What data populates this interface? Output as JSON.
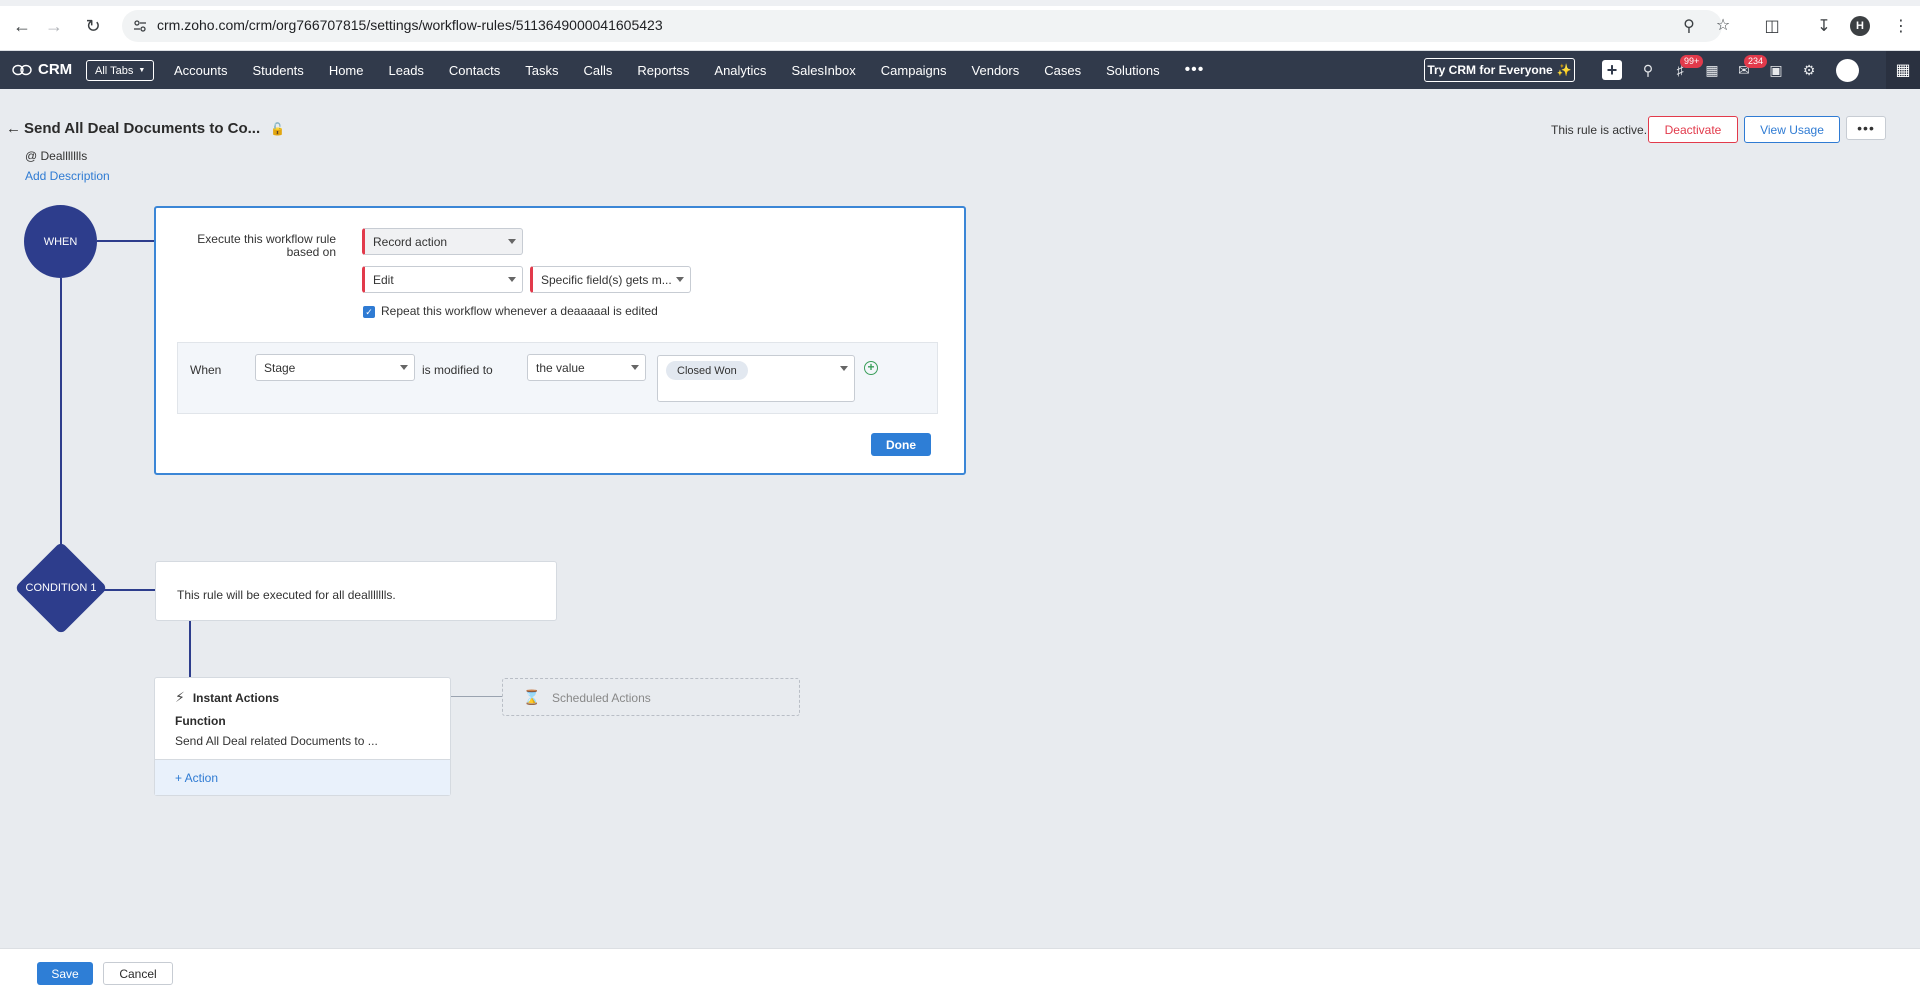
{
  "browser": {
    "url": "crm.zoho.com/crm/org766707815/settings/workflow-rules/5113649000041605423",
    "profile_initial": "H"
  },
  "crm": {
    "logo": "CRM",
    "all_tabs": "All Tabs",
    "tabs": [
      "Accounts",
      "Students",
      "Home",
      "Leads",
      "Contacts",
      "Tasks",
      "Calls",
      "Reportss",
      "Analytics",
      "SalesInbox",
      "Campaigns",
      "Vendors",
      "Cases",
      "Solutions"
    ],
    "more": "•••",
    "try_button": "Try CRM for Everyone",
    "notif_badge": "99+",
    "mail_badge": "234"
  },
  "rule": {
    "title": "Send All Deal Documents to Co...",
    "module": "@ Deallllllls",
    "add_description": "Add Description",
    "status_text": "This rule is active.",
    "deactivate": "Deactivate",
    "view_usage": "View Usage",
    "more": "•••"
  },
  "flow": {
    "when_node": "WHEN",
    "condition_node": "CONDITION 1"
  },
  "when_panel": {
    "exec_label": "Execute this workflow rule based on",
    "trigger_type": "Record action",
    "action": "Edit",
    "field_trigger": "Specific field(s) gets m...",
    "repeat_checked": true,
    "repeat_label": "Repeat this workflow whenever a deaaaaal is edited",
    "when_label": "When",
    "field": "Stage",
    "operator_text": "is modified to",
    "value_type": "the value",
    "value_chip": "Closed Won",
    "done": "Done"
  },
  "condition_panel": {
    "text": "This rule will be executed for all deallllllls."
  },
  "instant_actions": {
    "title": "Instant Actions",
    "type": "Function",
    "description": "Send All Deal related Documents to ...",
    "add_action": "+ Action"
  },
  "scheduled_actions": {
    "title": "Scheduled Actions"
  },
  "footer": {
    "save": "Save",
    "cancel": "Cancel"
  }
}
